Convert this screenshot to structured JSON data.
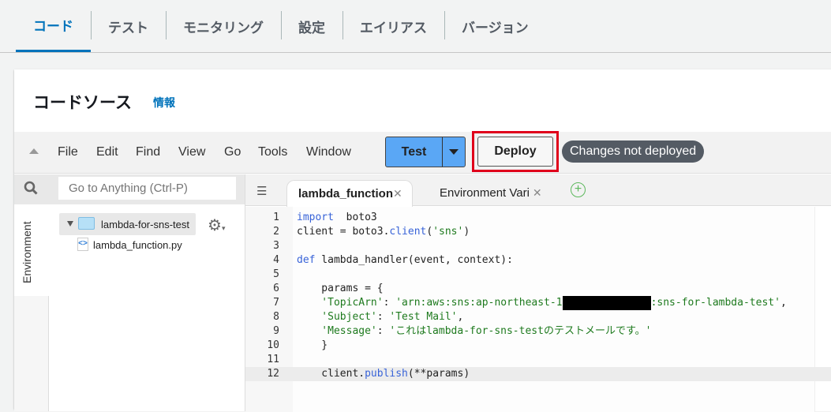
{
  "tabs": [
    "コード",
    "テスト",
    "モニタリング",
    "設定",
    "エイリアス",
    "バージョン"
  ],
  "active_tab": 0,
  "section": {
    "title": "コードソース",
    "info": "情報"
  },
  "menu": [
    "File",
    "Edit",
    "Find",
    "View",
    "Go",
    "Tools",
    "Window"
  ],
  "toolbar": {
    "test": "Test",
    "deploy": "Deploy",
    "status": "Changes not deployed"
  },
  "sidebar": {
    "search_placeholder": "Go to Anything (Ctrl-P)",
    "panel": "Environment",
    "folder": "lambda-for-sns-test",
    "file": "lambda_function.py"
  },
  "editor_tabs": [
    {
      "label": "lambda_function",
      "active": true
    },
    {
      "label": "Environment Vari",
      "active": false
    }
  ],
  "code": [
    {
      "n": "1",
      "parts": [
        [
          "kw",
          "import"
        ],
        [
          "",
          "  boto3"
        ]
      ]
    },
    {
      "n": "2",
      "parts": [
        [
          "",
          "client = boto3."
        ],
        [
          "fn",
          "client"
        ],
        [
          "",
          "("
        ],
        [
          "st",
          "'sns'"
        ],
        [
          "",
          ")"
        ]
      ]
    },
    {
      "n": "3",
      "parts": []
    },
    {
      "n": "4",
      "parts": [
        [
          "kw",
          "def"
        ],
        [
          "",
          " lambda_handler(event, context):"
        ]
      ]
    },
    {
      "n": "5",
      "parts": []
    },
    {
      "n": "6",
      "parts": [
        [
          "",
          "    params = {"
        ]
      ]
    },
    {
      "n": "7",
      "parts": [
        [
          "st",
          "    'TopicArn'"
        ],
        [
          "",
          ": "
        ],
        [
          "st",
          "'arn:aws:sns:ap-northeast-1"
        ],
        [
          "redact",
          ""
        ],
        [
          "st",
          ":sns-for-lambda-test'"
        ],
        [
          "",
          ","
        ]
      ]
    },
    {
      "n": "8",
      "parts": [
        [
          "st",
          "    'Subject'"
        ],
        [
          "",
          ": "
        ],
        [
          "st",
          "'Test Mail'"
        ],
        [
          "",
          ","
        ]
      ]
    },
    {
      "n": "9",
      "parts": [
        [
          "st",
          "    'Message'"
        ],
        [
          "",
          ": "
        ],
        [
          "st",
          "'これはlambda-for-sns-testのテストメールです。'"
        ]
      ]
    },
    {
      "n": "10",
      "parts": [
        [
          "",
          "    }"
        ]
      ]
    },
    {
      "n": "11",
      "parts": []
    },
    {
      "n": "12",
      "parts": [
        [
          "",
          "    client."
        ],
        [
          "fn",
          "publish"
        ],
        [
          "",
          "(**params)"
        ]
      ]
    }
  ],
  "current_line": 12,
  "colors": {
    "accent": "#0073bb",
    "test_button": "#5aa7f5",
    "highlight": "#e0001b"
  }
}
